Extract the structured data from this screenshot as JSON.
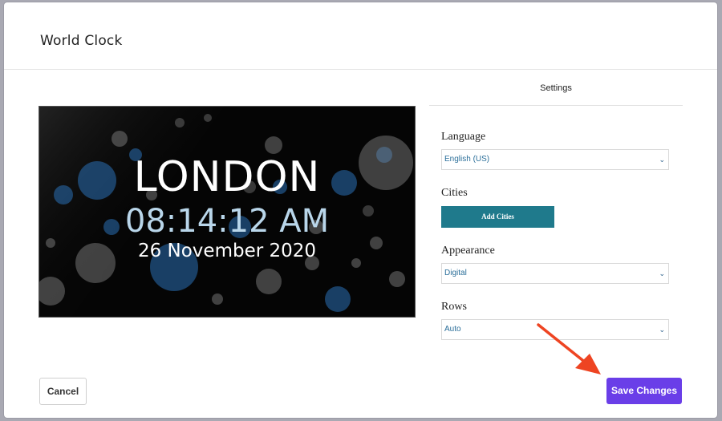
{
  "modal": {
    "title": "World Clock"
  },
  "preview": {
    "city": "LONDON",
    "time": "08:14:12 AM",
    "date": "26 November 2020"
  },
  "settings": {
    "heading": "Settings",
    "language": {
      "label": "Language",
      "value": "English (US)"
    },
    "cities": {
      "label": "Cities",
      "button_label": "Add Cities"
    },
    "appearance": {
      "label": "Appearance",
      "value": "Digital"
    },
    "rows": {
      "label": "Rows",
      "value": "Auto"
    }
  },
  "footer": {
    "cancel_label": "Cancel",
    "save_label": "Save Changes"
  },
  "colors": {
    "save_button": "#6a3ee8",
    "add_cities_button": "#1f7a8c",
    "annotation_arrow": "#ee4422",
    "time_text": "#b9d6ea"
  }
}
